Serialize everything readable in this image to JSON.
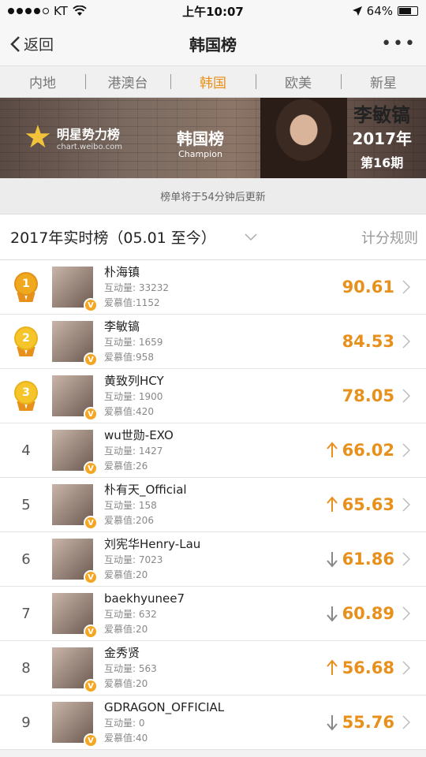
{
  "status": {
    "carrier": "KT",
    "time": "上午10:07",
    "battery": "64%",
    "battery_level": 0.64
  },
  "nav": {
    "back_label": "返回",
    "title": "韩国榜",
    "more": "•••"
  },
  "tabs": [
    {
      "label": "内地",
      "active": false
    },
    {
      "label": "港澳台",
      "active": false
    },
    {
      "label": "韩国",
      "active": true
    },
    {
      "label": "欧美",
      "active": false
    },
    {
      "label": "新星",
      "active": false
    }
  ],
  "banner": {
    "logo_text": "明星势力榜",
    "logo_sub": "chart.weibo.com",
    "center_title": "韩国榜",
    "center_sub": "Champion",
    "person_name": "李敏镐",
    "year": "2017年",
    "issue": "第16期"
  },
  "update_notice": "榜单将于54分钟后更新",
  "section": {
    "title": "2017年实时榜（05.01 至今）",
    "rules": "计分规则"
  },
  "labels": {
    "interaction": "互动量:",
    "love": "爱慕值:"
  },
  "rows": [
    {
      "rank": "1",
      "medal": "orange",
      "name": "朴海镇",
      "interaction": "33232",
      "love": "1152",
      "trend": "",
      "score": "90.61"
    },
    {
      "rank": "2",
      "medal": "gold",
      "name": "李敏镐",
      "interaction": "1659",
      "love": "958",
      "trend": "",
      "score": "84.53"
    },
    {
      "rank": "3",
      "medal": "gold",
      "name": "黄致列HCY",
      "interaction": "1900",
      "love": "420",
      "trend": "",
      "score": "78.05"
    },
    {
      "rank": "4",
      "medal": "",
      "name": "wu世勋-EXO",
      "interaction": "1427",
      "love": "26",
      "trend": "up",
      "score": "66.02"
    },
    {
      "rank": "5",
      "medal": "",
      "name": "朴有天_Official",
      "interaction": "158",
      "love": "206",
      "trend": "up",
      "score": "65.63"
    },
    {
      "rank": "6",
      "medal": "",
      "name": "刘宪华Henry-Lau",
      "interaction": "7023",
      "love": "20",
      "trend": "down",
      "score": "61.86"
    },
    {
      "rank": "7",
      "medal": "",
      "name": "baekhyunee7",
      "interaction": "632",
      "love": "20",
      "trend": "down",
      "score": "60.89"
    },
    {
      "rank": "8",
      "medal": "",
      "name": "金秀贤",
      "interaction": "563",
      "love": "20",
      "trend": "up",
      "score": "56.68"
    },
    {
      "rank": "9",
      "medal": "",
      "name": "GDRAGON_OFFICIAL",
      "interaction": "0",
      "love": "40",
      "trend": "down",
      "score": "55.76"
    }
  ],
  "colors": {
    "accent": "#e8901c",
    "medal_gold": "#f5c52a",
    "medal_orange": "#f0a81e",
    "verified": "#f5a623"
  },
  "icons": {
    "back": "chevron-left-icon",
    "more": "more-dots-icon",
    "wifi": "wifi-icon",
    "location": "location-arrow-icon",
    "battery": "battery-icon",
    "dropdown": "chevron-down-icon",
    "row_arrow": "chevron-right-icon",
    "verified": "verified-v-icon",
    "trend_up": "arrow-up-icon",
    "trend_down": "arrow-down-icon"
  }
}
